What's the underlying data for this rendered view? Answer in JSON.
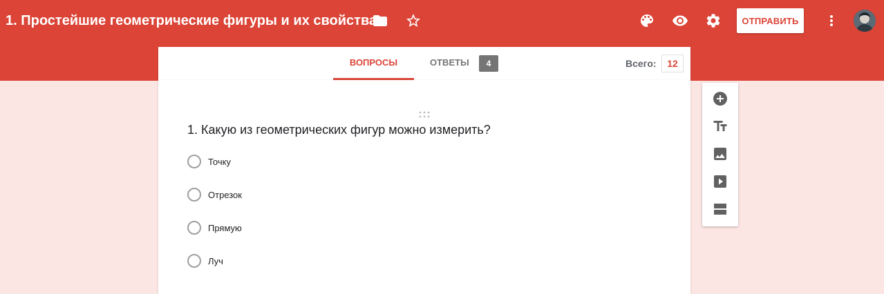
{
  "header": {
    "title": "1. Простейшие геометрические фигуры и их свойства",
    "send_label": "ОТПРАВИТЬ",
    "icons": [
      "folder-icon",
      "star-icon",
      "palette-icon",
      "preview-eye-icon",
      "settings-gear-icon",
      "more-vert-icon"
    ],
    "accent_color": "#db4437"
  },
  "tabs": {
    "questions_label": "ВОПРОСЫ",
    "answers_label": "ОТВЕТЫ",
    "answers_count": "4",
    "total_label": "Всего:",
    "total_value": "12"
  },
  "question": {
    "title": "1. Какую из геометрических фигур можно измерить?",
    "options": [
      "Точку",
      "Отрезок",
      "Прямую",
      "Луч"
    ]
  },
  "toolbar": {
    "tools": [
      "add-question-icon",
      "add-title-icon",
      "add-image-icon",
      "add-video-icon",
      "add-section-icon"
    ]
  }
}
